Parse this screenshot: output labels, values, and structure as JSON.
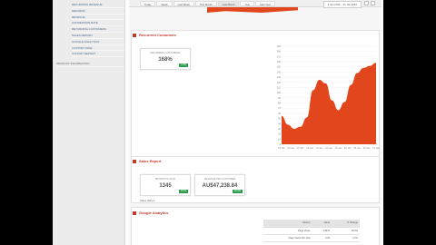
{
  "sidebar": {
    "items": [
      {
        "label": "RECURRING REVENUE"
      },
      {
        "label": "REFUNDS"
      },
      {
        "label": "REVENUE"
      },
      {
        "label": "CONVERSION RATE"
      },
      {
        "label": "RETURNING CUSTOMERS"
      },
      {
        "label": "SALES REPORT"
      },
      {
        "label": "GOOGLE ANALYTICS"
      },
      {
        "label": "CUSTOM CODE"
      },
      {
        "label": "COHORT REPORT"
      }
    ],
    "footer_item": "PRODUCT INFORMATION"
  },
  "topbar": {
    "tabs": [
      {
        "label": "Today"
      },
      {
        "label": "Week"
      },
      {
        "label": "Last Week"
      },
      {
        "label": "This Month"
      },
      {
        "label": "Last Month"
      },
      {
        "label": "Year"
      },
      {
        "label": "Last Year"
      }
    ],
    "active_tab": 4,
    "range": "1 Jan 2014 – 31 Jan 2014"
  },
  "recurrent_customers": {
    "title": "Recurrent Customers",
    "kpi_label": "RECURRING CUSTOMERS",
    "kpi_value": "168%",
    "kpi_badge": "4.1%",
    "y_ticks": [
      "190",
      "180",
      "170",
      "160",
      "150",
      "140",
      "130",
      "120",
      "110",
      "100",
      "90",
      "80",
      "70",
      "60",
      "50",
      "40",
      "30",
      "20",
      "10",
      "0"
    ],
    "x_ticks": [
      "01 Jan",
      "04 Jan",
      "07 Jan",
      "10 Jan",
      "13 Jan",
      "16 Jan",
      "19 Jan",
      "22 Jan",
      "25 Jan",
      "28 Jan",
      "31 Jan"
    ]
  },
  "chart_data": {
    "type": "area",
    "x": [
      0,
      2,
      4,
      6,
      8,
      10,
      12,
      14,
      16,
      18,
      20,
      22,
      24,
      26,
      28,
      30
    ],
    "values": [
      55,
      38,
      30,
      34,
      52,
      105,
      125,
      118,
      85,
      66,
      82,
      115,
      138,
      148,
      152,
      158
    ],
    "ylim": [
      0,
      190
    ],
    "color": "#e1461d",
    "grid": true
  },
  "sales_report": {
    "title": "Sales Report",
    "kpis": [
      {
        "label": "PRODUCTS SOLD",
        "value": "1345",
        "badge": "8.7%"
      },
      {
        "label": "REVENUE PER CUSTOMER",
        "value": "AU$47,238.84",
        "badge": "10.6%"
      }
    ],
    "note": "Sales Values"
  },
  "google_analytics": {
    "title": "Google Analytics",
    "headers": [
      "Metrics",
      "Value",
      "% Change"
    ],
    "rows": [
      [
        "Page Views",
        "24975",
        "18.5%"
      ],
      [
        "Page Views Per Visit",
        "4.93",
        "3.7%"
      ]
    ]
  },
  "colors": {
    "accent": "#e1461d",
    "title_red": "#c0392b",
    "badge_green": "#2e9e4f"
  }
}
